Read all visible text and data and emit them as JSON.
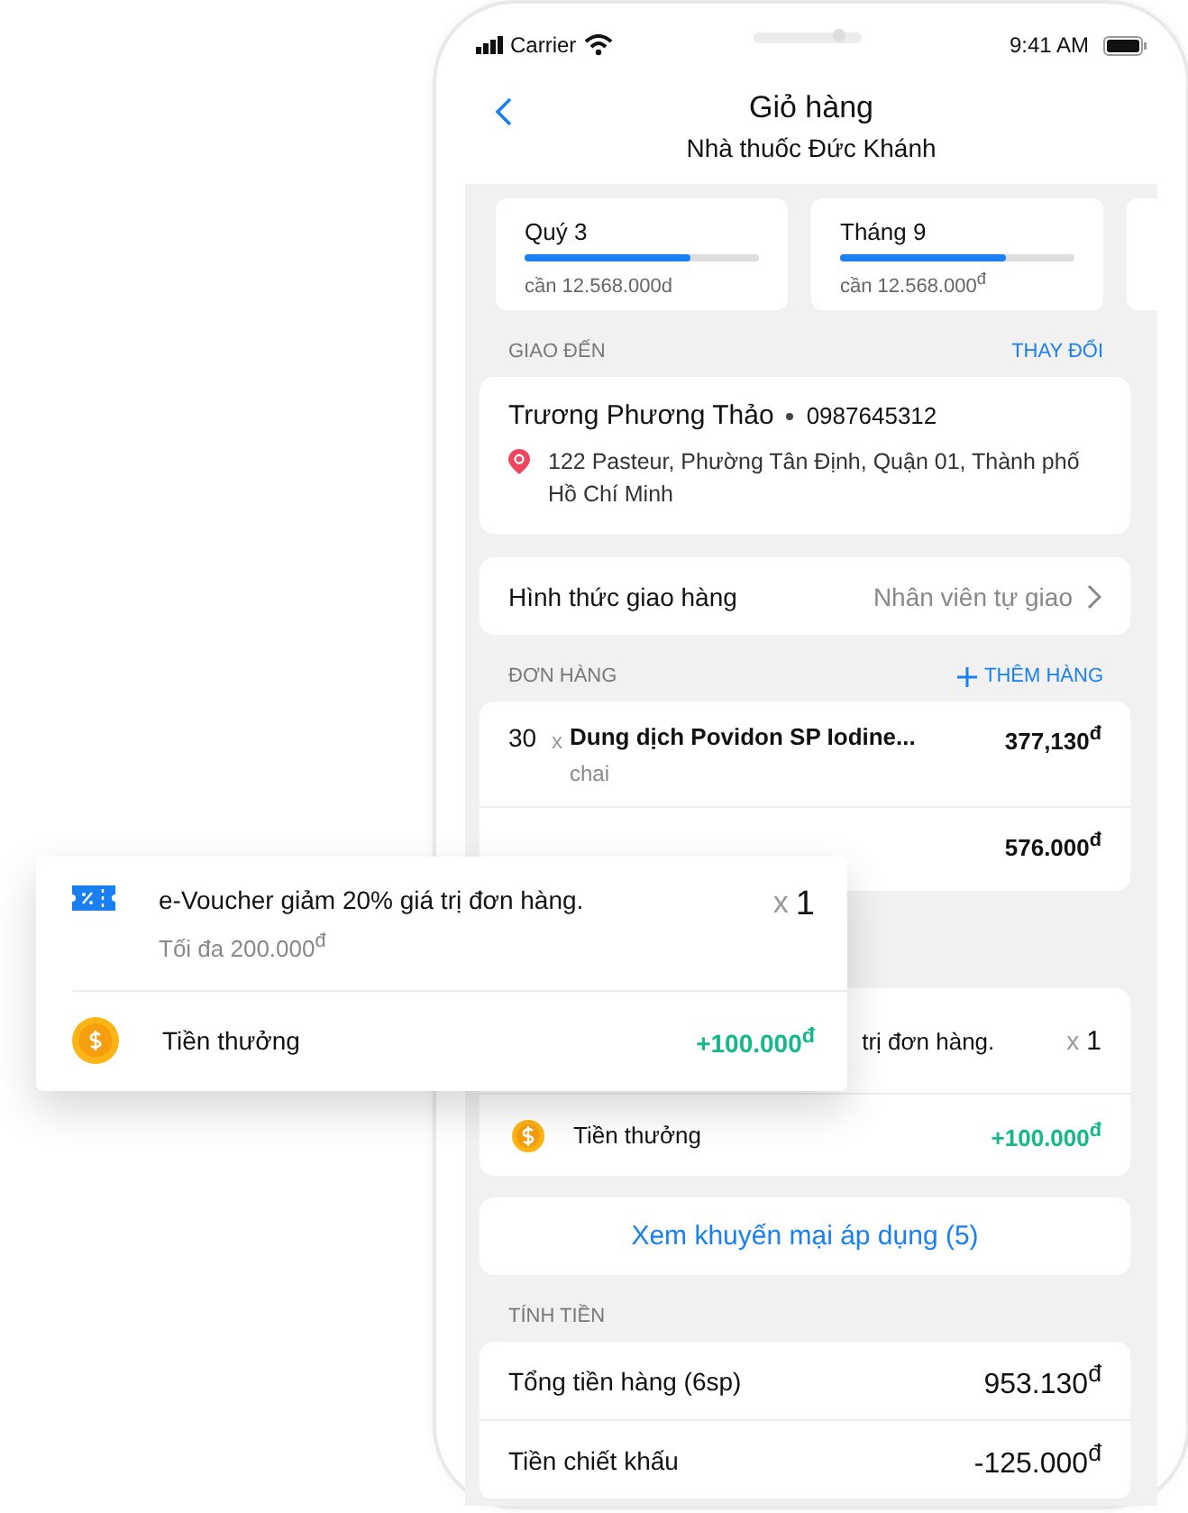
{
  "status_bar": {
    "carrier": "Carrier",
    "time": "9:41 AM"
  },
  "header": {
    "title": "Giỏ hàng",
    "subtitle": "Nhà thuốc Đức Khánh"
  },
  "targets": [
    {
      "label": "Quý 3",
      "level": 0.71,
      "remaining": "cần 12.568.000d"
    },
    {
      "label": "Tháng 9",
      "level": 0.71,
      "remaining": "cần 12.568.000$^{đ}$"
    }
  ],
  "delivery": {
    "section": "GIAO ĐẾN",
    "action": "THAY ĐỔI",
    "name": "Trương Phương Thảo",
    "phone": "0987645312",
    "address": "122 Pasteur, Phường Tân Định, Quận 01, Thành phố Hồ Chí Minh"
  },
  "shipping": {
    "label": "Hình thức giao hàng",
    "value": "Nhân viên tự giao"
  },
  "order": {
    "section": "ĐƠN HÀNG",
    "action": "THÊM HÀNG",
    "items": [
      {
        "quantity": "30",
        "times": "x",
        "name": "Dung dịch Povidon SP Iodine...",
        "unit": "chai",
        "price": "377,130$^{đ}$"
      },
      {
        "price": "576.000$^{đ}$"
      }
    ]
  },
  "promotions": [
    {
      "kind": "voucher",
      "title": "trị đơn hàng.",
      "times": "x",
      "count": "1"
    },
    {
      "kind": "bonus",
      "title": "Tiền thưởng",
      "amount": "+100.000$^{đ}$"
    }
  ],
  "promo_link": "Xem khuyến mại áp dụng (5)",
  "totals": {
    "section": "TÍNH TIỀN",
    "rows": [
      {
        "label": "Tổng tiền hàng (6sp)",
        "value": "953.130$^{đ}$"
      },
      {
        "label": "Tiền chiết khấu",
        "value": "-125.000$^{đ}$"
      }
    ]
  },
  "popup": [
    {
      "kind": "voucher",
      "title": "e-Voucher giảm 20% giá trị đơn hàng.",
      "note": "Tối đa 200.000$^{đ}$",
      "times": "x",
      "count": "1"
    },
    {
      "kind": "bonus",
      "title": "Tiền thưởng",
      "amount": "+100.000$^{đ}$"
    }
  ]
}
